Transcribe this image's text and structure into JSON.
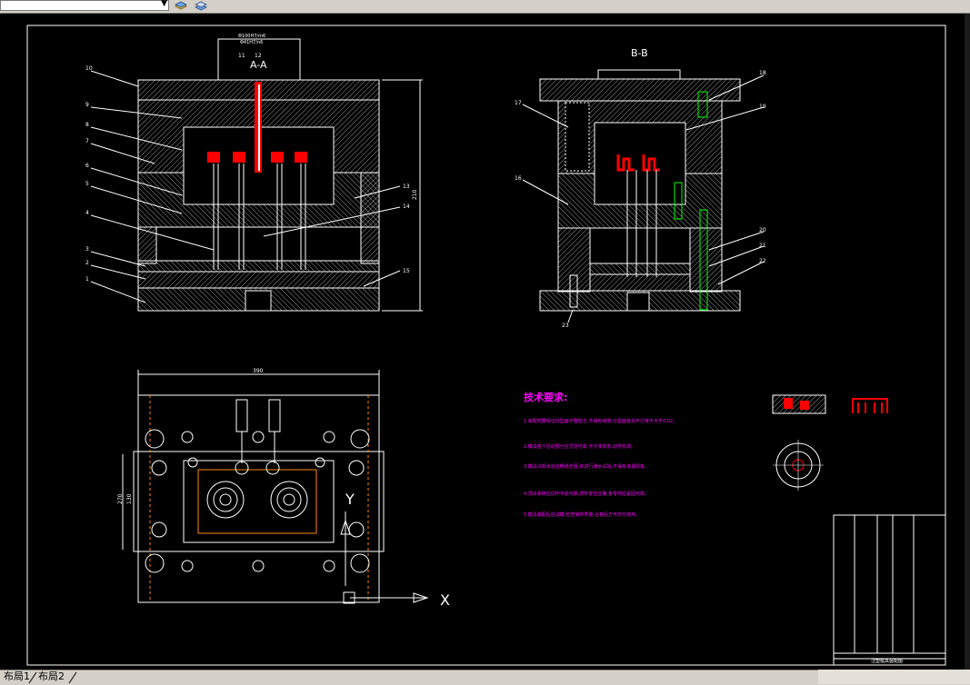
{
  "app": {
    "layer_dropdown_value": "",
    "toolbar_icons": [
      "layers-icon",
      "layer-state-icon"
    ]
  },
  "drawing": {
    "section_aa_label": "A-A",
    "section_bb_label": "B-B",
    "tech_title": "技术要求:",
    "tech_items": [
      "1.装配时要保证分型面平整密合,不得有缝隙,分型面各处平行度不大于0.02。",
      "2.模具各个活动部分应灵活可靠,无卡滞现象,动作协调。",
      "3.模具冷却水道应畅通无阻,并进行通水试验,不得有渗漏现象。",
      "4.顶出系统应动作平稳可靠,顶杆复位正确,各零件应紧固可靠。",
      "5.模具装配后应试模,检查制件质量,合格后方可交付使用。"
    ],
    "top_dim_1": "Φ100H7/m6",
    "top_dim_2": "Φ41H7/n6",
    "width_dim": "390",
    "height_dim": "210",
    "plan_dim_1": "270",
    "plan_dim_2": "130",
    "axis_x": "X",
    "axis_y": "Y",
    "title_block_caption": "注塑模具装配图",
    "callouts_left": [
      "10",
      "9",
      "8",
      "7",
      "6",
      "5",
      "4",
      "3",
      "2",
      "1"
    ],
    "callouts_mid": [
      "11",
      "12",
      "13",
      "14",
      "15"
    ],
    "callouts_right": [
      "18",
      "19",
      "17",
      "16",
      "20",
      "21",
      "22",
      "23"
    ]
  },
  "statusbar": {
    "tabs": [
      "布局1",
      "布局2"
    ]
  },
  "colors": {
    "background": "#000000",
    "lines": "#ffffff",
    "accent_red": "#ff0000",
    "tech_title": "#ff00ff",
    "tech_text": "#ff00ff"
  }
}
